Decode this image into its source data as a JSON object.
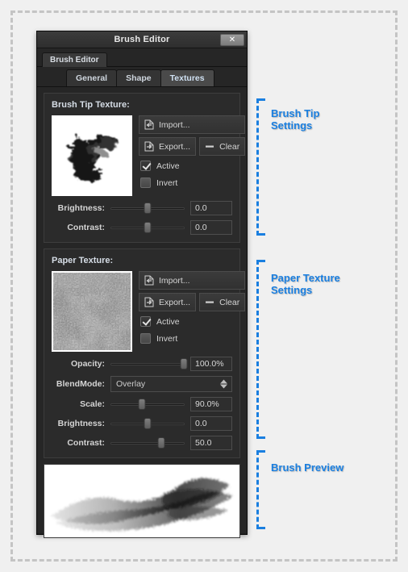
{
  "window": {
    "title": "Brush Editor",
    "close_label": "✕",
    "outer_tab": "Brush Editor",
    "inner_tabs": [
      {
        "label": "General",
        "active": false
      },
      {
        "label": "Shape",
        "active": false
      },
      {
        "label": "Textures",
        "active": true
      }
    ]
  },
  "brush_tip": {
    "title": "Brush Tip Texture:",
    "import_label": "Import...",
    "export_label": "Export...",
    "clear_label": "Clear",
    "active_label": "Active",
    "active_checked": true,
    "invert_label": "Invert",
    "invert_checked": false,
    "sliders": [
      {
        "label": "Brightness:",
        "value": "0.0",
        "pct": 50
      },
      {
        "label": "Contrast:",
        "value": "0.0",
        "pct": 50
      }
    ]
  },
  "paper": {
    "title": "Paper Texture:",
    "import_label": "Import...",
    "export_label": "Export...",
    "clear_label": "Clear",
    "active_label": "Active",
    "active_checked": true,
    "invert_label": "Invert",
    "invert_checked": false,
    "opacity": {
      "label": "Opacity:",
      "value": "100.0%",
      "pct": 100
    },
    "blendmode": {
      "label": "BlendMode:",
      "value": "Overlay"
    },
    "scale": {
      "label": "Scale:",
      "value": "90.0%",
      "pct": 42
    },
    "brightness": {
      "label": "Brightness:",
      "value": "0.0",
      "pct": 50
    },
    "contrast": {
      "label": "Contrast:",
      "value": "50.0",
      "pct": 68
    }
  },
  "annotations": {
    "accent_color": "#1a7fe0",
    "items": [
      {
        "text": "Brush Tip\nSettings"
      },
      {
        "text": "Paper Texture\nSettings"
      },
      {
        "text": "Brush Preview"
      }
    ]
  }
}
